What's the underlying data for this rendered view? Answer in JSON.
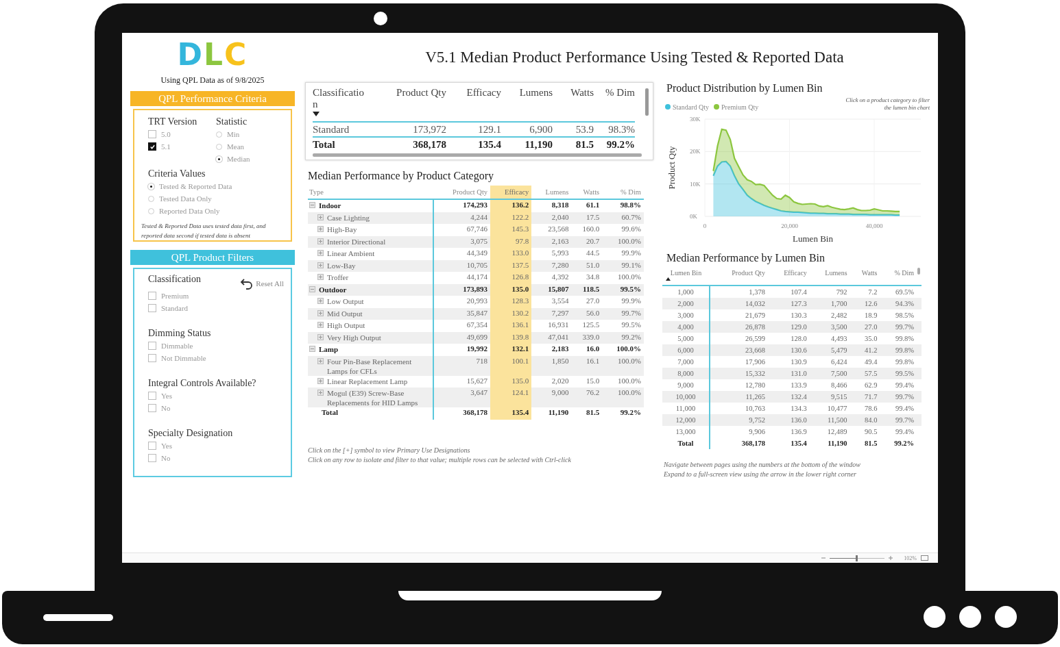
{
  "header": {
    "logo": "DLC",
    "data_date": "Using QPL Data as of 9/8/2025",
    "title": "V5.1 Median Product Performance Using Tested & Reported Data"
  },
  "criteria": {
    "title": "QPL Performance Criteria",
    "trt_version": {
      "label": "TRT Version",
      "options": [
        {
          "label": "5.0",
          "checked": false
        },
        {
          "label": "5.1",
          "checked": true
        }
      ]
    },
    "statistic": {
      "label": "Statistic",
      "options": [
        {
          "label": "Min",
          "selected": false
        },
        {
          "label": "Mean",
          "selected": false
        },
        {
          "label": "Median",
          "selected": true
        }
      ]
    },
    "criteria_values": {
      "label": "Criteria Values",
      "options": [
        {
          "label": "Tested & Reported Data",
          "selected": true
        },
        {
          "label": "Tested Data Only",
          "selected": false
        },
        {
          "label": "Reported Data Only",
          "selected": false
        }
      ]
    },
    "note": "Tested & Reported Data uses tested data first, and reported data second if tested data is absent"
  },
  "filters": {
    "title": "QPL Product Filters",
    "reset": "Reset All",
    "groups": [
      {
        "label": "Classification",
        "options": [
          {
            "label": "Premium",
            "checked": false
          },
          {
            "label": "Standard",
            "checked": false
          }
        ]
      },
      {
        "label": "Dimming Status",
        "options": [
          {
            "label": "Dimmable",
            "checked": false
          },
          {
            "label": "Not Dimmable",
            "checked": false
          }
        ]
      },
      {
        "label": "Integral Controls Available?",
        "options": [
          {
            "label": "Yes",
            "checked": false
          },
          {
            "label": "No",
            "checked": false
          }
        ]
      },
      {
        "label": "Specialty Designation",
        "options": [
          {
            "label": "Yes",
            "checked": false
          },
          {
            "label": "No",
            "checked": false
          }
        ]
      }
    ]
  },
  "summary_table": {
    "sort_ascending": false,
    "columns": [
      {
        "label": "Classification",
        "sorted": true
      },
      {
        "label": "Product Qty",
        "sorted": false
      },
      {
        "label": "Efficacy",
        "sorted": false
      },
      {
        "label": "Lumens",
        "sorted": false
      },
      {
        "label": "Watts",
        "sorted": false
      },
      {
        "label": "% Dim",
        "sorted": false
      }
    ],
    "rows": [
      [
        "Standard",
        "173,972",
        "129.1",
        "6,900",
        "53.9",
        "98.3%"
      ]
    ],
    "total": [
      "Total",
      "368,178",
      "135.4",
      "11,190",
      "81.5",
      "99.2%"
    ]
  },
  "category_table": {
    "title": "Median Performance by Product Category",
    "columns": [
      {
        "label": "Type",
        "highlighted": false
      },
      {
        "label": "Product Qty",
        "highlighted": false
      },
      {
        "label": "Efficacy",
        "highlighted": true
      },
      {
        "label": "Lumens",
        "highlighted": false
      },
      {
        "label": "Watts",
        "highlighted": false
      },
      {
        "label": "% Dim",
        "highlighted": false
      }
    ],
    "rows": [
      {
        "cells": [
          "Indoor",
          "174,293",
          "136.2",
          "8,318",
          "61.1",
          "98.8%"
        ],
        "expanded": true,
        "children": [
          {
            "cells": [
              "Case Lighting",
              "4,244",
              "122.2",
              "2,040",
              "17.5",
              "60.7%"
            ],
            "expanded": false
          },
          {
            "cells": [
              "High-Bay",
              "67,746",
              "145.3",
              "23,568",
              "160.0",
              "99.6%"
            ],
            "expanded": false
          },
          {
            "cells": [
              "Interior Directional",
              "3,075",
              "97.8",
              "2,163",
              "20.7",
              "100.0%"
            ],
            "expanded": false
          },
          {
            "cells": [
              "Linear Ambient",
              "44,349",
              "133.0",
              "5,993",
              "44.5",
              "99.9%"
            ],
            "expanded": false
          },
          {
            "cells": [
              "Low-Bay",
              "10,705",
              "137.5",
              "7,280",
              "51.0",
              "99.1%"
            ],
            "expanded": false
          },
          {
            "cells": [
              "Troffer",
              "44,174",
              "126.8",
              "4,392",
              "34.8",
              "100.0%"
            ],
            "expanded": false
          }
        ]
      },
      {
        "cells": [
          "Outdoor",
          "173,893",
          "135.0",
          "15,807",
          "118.5",
          "99.5%"
        ],
        "expanded": true,
        "children": [
          {
            "cells": [
              "Low Output",
              "20,993",
              "128.3",
              "3,554",
              "27.0",
              "99.9%"
            ],
            "expanded": false
          },
          {
            "cells": [
              "Mid Output",
              "35,847",
              "130.2",
              "7,297",
              "56.0",
              "99.7%"
            ],
            "expanded": false
          },
          {
            "cells": [
              "High Output",
              "67,354",
              "136.1",
              "16,931",
              "125.5",
              "99.5%"
            ],
            "expanded": false
          },
          {
            "cells": [
              "Very High Output",
              "49,699",
              "139.8",
              "47,041",
              "339.0",
              "99.2%"
            ],
            "expanded": false
          }
        ]
      },
      {
        "cells": [
          "Lamp",
          "19,992",
          "132.1",
          "2,183",
          "16.0",
          "100.0%"
        ],
        "expanded": true,
        "children": [
          {
            "cells": [
              "Four Pin-Base Replacement Lamps for CFLs",
              "718",
              "100.1",
              "1,850",
              "16.1",
              "100.0%"
            ],
            "expanded": false
          },
          {
            "cells": [
              "Linear Replacement Lamp",
              "15,627",
              "135.0",
              "2,020",
              "15.0",
              "100.0%"
            ],
            "expanded": false
          },
          {
            "cells": [
              "Mogul (E39) Screw-Base Replacements for HID Lamps",
              "3,647",
              "124.1",
              "9,000",
              "76.2",
              "100.0%"
            ],
            "expanded": false
          }
        ]
      }
    ],
    "total": [
      "Total",
      "368,178",
      "135.4",
      "11,190",
      "81.5",
      "99.2%"
    ],
    "notes": [
      "Click on the [+] symbol to view Primary Use Designations",
      "Click on any row to isolate and filter to that value; multiple rows can be selected with Ctrl-click"
    ]
  },
  "distribution_chart": {
    "title": "Product Distribution by Lumen Bin",
    "note": "Click on a product category to filter the lumen bin chart",
    "chart_data": {
      "type": "area",
      "grid": true,
      "xlabel": "Lumen Bin",
      "ylabel": "Product Qty",
      "stacked": true,
      "xlim": [
        0,
        51000
      ],
      "ylim": [
        0,
        30000
      ],
      "xticks": [
        {
          "value": 0,
          "label": "0"
        },
        {
          "value": 20000,
          "label": "20,000"
        },
        {
          "value": 40000,
          "label": "40,000"
        }
      ],
      "yticks": [
        {
          "value": 0,
          "label": "0K"
        },
        {
          "value": 10000,
          "label": "10K"
        },
        {
          "value": 20000,
          "label": "20K"
        },
        {
          "value": 30000,
          "label": "30K"
        }
      ],
      "x": [
        2000,
        3000,
        4000,
        5000,
        6000,
        7000,
        8000,
        9000,
        10000,
        11000,
        12000,
        13000,
        14000,
        15000,
        16000,
        17000,
        18000,
        19000,
        20000,
        21000,
        22000,
        23000,
        24000,
        25000,
        26000,
        27000,
        28000,
        29000,
        30000,
        31000,
        32000,
        33000,
        34000,
        35000,
        36000,
        37000,
        38000,
        39000,
        40000,
        41000,
        42000,
        43000,
        44000,
        45000,
        46000
      ],
      "series": [
        {
          "name": "Standard Qty",
          "color": "#3fc1dc",
          "values": [
            12500,
            15500,
            16800,
            16900,
            15500,
            12500,
            10000,
            8300,
            6500,
            5500,
            4600,
            4000,
            3400,
            2900,
            2500,
            2100,
            1700,
            1500,
            1400,
            1300,
            1300,
            1200,
            1100,
            1000,
            1000,
            900,
            900,
            800,
            800,
            800,
            700,
            700,
            700,
            600,
            600,
            600,
            600,
            500,
            500,
            500,
            500,
            500,
            500,
            400,
            400
          ]
        },
        {
          "name": "Premium Qty",
          "color": "#8cc63f",
          "values": [
            1500,
            6200,
            10100,
            9700,
            8200,
            5400,
            5300,
            4500,
            4800,
            5300,
            5200,
            5900,
            6100,
            5100,
            4000,
            3400,
            3600,
            5000,
            4400,
            3200,
            2700,
            2500,
            2700,
            2900,
            2800,
            2300,
            2100,
            2500,
            2000,
            1700,
            1500,
            1400,
            1600,
            2000,
            1500,
            1200,
            1200,
            1400,
            1800,
            1500,
            1200,
            1200,
            1100,
            1100,
            1100
          ]
        }
      ]
    }
  },
  "lumen_table": {
    "title": "Median Performance by Lumen Bin",
    "sort_ascending": true,
    "columns": [
      {
        "label": "Lumen Bin",
        "sorted": true
      },
      {
        "label": "Product Qty",
        "sorted": false
      },
      {
        "label": "Efficacy",
        "sorted": false
      },
      {
        "label": "Lumens",
        "sorted": false
      },
      {
        "label": "Watts",
        "sorted": false
      },
      {
        "label": "% Dim",
        "sorted": false
      }
    ],
    "rows": [
      [
        "1,000",
        "1,378",
        "107.4",
        "792",
        "7.2",
        "69.5%"
      ],
      [
        "2,000",
        "14,032",
        "127.3",
        "1,700",
        "12.6",
        "94.3%"
      ],
      [
        "3,000",
        "21,679",
        "130.3",
        "2,482",
        "18.9",
        "98.5%"
      ],
      [
        "4,000",
        "26,878",
        "129.0",
        "3,500",
        "27.0",
        "99.7%"
      ],
      [
        "5,000",
        "26,599",
        "128.0",
        "4,493",
        "35.0",
        "99.8%"
      ],
      [
        "6,000",
        "23,668",
        "130.6",
        "5,479",
        "41.2",
        "99.8%"
      ],
      [
        "7,000",
        "17,906",
        "130.9",
        "6,424",
        "49.4",
        "99.8%"
      ],
      [
        "8,000",
        "15,332",
        "131.0",
        "7,500",
        "57.5",
        "99.5%"
      ],
      [
        "9,000",
        "12,780",
        "133.9",
        "8,466",
        "62.9",
        "99.4%"
      ],
      [
        "10,000",
        "11,265",
        "132.4",
        "9,515",
        "71.7",
        "99.7%"
      ],
      [
        "11,000",
        "10,763",
        "134.3",
        "10,477",
        "78.6",
        "99.4%"
      ],
      [
        "12,000",
        "9,752",
        "136.0",
        "11,500",
        "84.0",
        "99.7%"
      ],
      [
        "13,000",
        "9,906",
        "136.9",
        "12,489",
        "90.5",
        "99.4%"
      ]
    ],
    "total": [
      "Total",
      "368,178",
      "135.4",
      "11,190",
      "81.5",
      "99.2%"
    ],
    "notes": [
      "Navigate between pages using the numbers at the bottom of the window",
      "Expand to a full-screen view using the arrow in the lower right corner"
    ]
  },
  "status_bar": {
    "zoom": "102%",
    "level": 0.5
  }
}
